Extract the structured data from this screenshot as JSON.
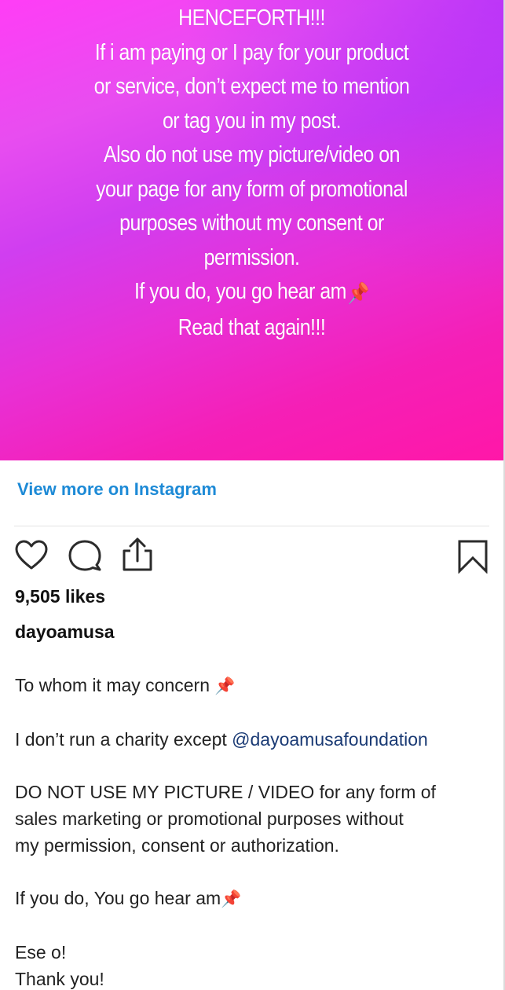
{
  "story": {
    "lines": [
      "HENCEFORTH!!!",
      "If i am paying or I pay for your product",
      "or service, don’t expect me to mention",
      "or tag you in my post.",
      "Also do not use my picture/video on",
      "your page for any form of promotional",
      "purposes without my consent or",
      "permission."
    ],
    "line_warning": "If you do, you go hear am",
    "line_read_again": "Read that again!!!",
    "pin_emoji": "📌"
  },
  "view_more_label": "View more on Instagram",
  "actions": {
    "like_icon": "heart-icon",
    "comment_icon": "comment-icon",
    "share_icon": "share-icon",
    "save_icon": "bookmark-icon"
  },
  "likes": "9,505 likes",
  "username": "dayoamusa",
  "caption": {
    "p1": "To whom it may concern",
    "p2_text": "I don’t run a charity except ",
    "p2_mention": "@dayoamusafoundation",
    "p3_lines": [
      "DO NOT USE MY PICTURE / VIDEO for any form of",
      "sales marketing or promotional purposes without",
      "my permission, consent or authorization."
    ],
    "p4": "If you do, You go hear am",
    "p5_lines": [
      "Ese o!",
      "Thank you!"
    ],
    "pin_emoji": "📌"
  },
  "colors": {
    "link": "#1d8ad6",
    "mention": "#1a3a74",
    "story_gradient_start": "#ff3df6",
    "story_gradient_end": "#ff17a8"
  }
}
